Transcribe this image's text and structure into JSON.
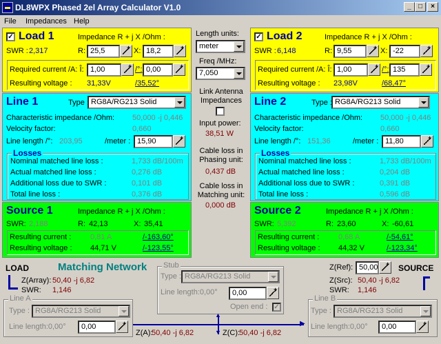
{
  "window": {
    "title": "DL8WPX Phased 2el Array Calculator V1.0",
    "min": "_",
    "max": "□",
    "close": "×"
  },
  "menu": [
    "File",
    "Impedances",
    "Help"
  ],
  "load1": {
    "title": "Load 1",
    "imp_label": "Impedance R + j X /Ohm :",
    "swr_label": "SWR :",
    "swr": "2,317",
    "r_label": "R:",
    "r": "25,5",
    "x_label": "X:",
    "x": "18,2",
    "req_label": "Required current /A: Î:",
    "i": "1,00",
    "phase_label": "/°:",
    "phase": "0,00",
    "volt_label": "Resulting voltage :",
    "volt": "31,33V",
    "volt_phase": "/35,52°"
  },
  "load2": {
    "title": "Load 2",
    "imp_label": "Impedance R + j X /Ohm :",
    "swr_label": "SWR :",
    "swr": "6,148",
    "r_label": "R:",
    "r": "9,55",
    "x_label": "X:",
    "x": "-22",
    "req_label": "Required current /A: Î:",
    "i": "1,00",
    "phase_label": "/°:",
    "phase": "135",
    "volt_label": "Resulting voltage :",
    "volt": "23,98V",
    "volt_phase": "/68,47°"
  },
  "line1": {
    "title": "Line 1",
    "type_label": "Type :",
    "type": "RG8A/RG213 Solid",
    "char_label": "Characteristic impedance /Ohm:",
    "char": "50,000 -j 0,446",
    "vf_label": "Velocity factor:",
    "vf": "0,660",
    "len_label": "Line length /°:",
    "len_deg": "203,95",
    "meter_label": "/meter :",
    "meter": "15,90",
    "losses_title": "Losses",
    "nom_label": "Nominal matched line loss :",
    "nom": "1,733 dB/100m",
    "act_label": "Actual matched line loss :",
    "act": "0,276 dB",
    "add_label": "Additional loss due to SWR :",
    "add": "0,101 dB",
    "tot_label": "Total line loss :",
    "tot": "0,376 dB"
  },
  "line2": {
    "title": "Line 2",
    "type_label": "Type :",
    "type": "RG8A/RG213 Solid",
    "char_label": "Characteristic impedance /Ohm:",
    "char": "50,000 -j 0,446",
    "vf_label": "Velocity factor:",
    "vf": "0,660",
    "len_label": "Line length /°:",
    "len_deg": "151,36",
    "meter_label": "/meter :",
    "meter": "11,80",
    "losses_title": "Losses",
    "nom_label": "Nominal matched line loss :",
    "nom": "1,733 dB/100m",
    "act_label": "Actual matched line loss :",
    "act": "0,204 dB",
    "add_label": "Additional loss due to SWR :",
    "add": "0,391 dB",
    "tot_label": "Total line loss :",
    "tot": "0,596 dB"
  },
  "source1": {
    "title": "Source 1",
    "imp_label": "Impedance R + j X /Ohm :",
    "swr_label": "SWR:",
    "swr": "2,188",
    "r_label": "R:",
    "r": "42,13",
    "x_label": "X:",
    "x": "35,41",
    "cur_label": "Resulting current :",
    "cur": "0,81 A",
    "cur_phase": "/-163,60°",
    "volt_label": "Resulting voltage :",
    "volt": "44,71 V",
    "volt_phase": "/-123,55°"
  },
  "source2": {
    "title": "Source 2",
    "imp_label": "Impedance R + j X /Ohm :",
    "swr_label": "SWR:",
    "swr": "5,392",
    "r_label": "R:",
    "r": "23,60",
    "x_label": "X:",
    "x": "-60,61",
    "cur_label": "Resulting current :",
    "cur": "0,68 A",
    "cur_phase": "/-54,61°",
    "volt_label": "Resulting voltage :",
    "volt": "44,32 V",
    "volt_phase": "/-123,34°"
  },
  "center": {
    "len_units_label": "Length units:",
    "len_units": "meter",
    "freq_label": "Freq /MHz:",
    "freq": "7,050",
    "link_label": "Link Antenna Impedances",
    "input_power_label": "Input power:",
    "input_power": "38,51 W",
    "phasing_label": "Cable loss in Phasing unit:",
    "phasing": "0,437 dB",
    "matching_label": "Cable loss in Matching unit:",
    "matching": "0,000 dB"
  },
  "matching": {
    "load_label": "LOAD",
    "title": "Matching Network",
    "zarray_label": "Z(Array):",
    "zarray": "50,40 -j 6,82",
    "swr_label": "SWR:",
    "swr": "1,146",
    "source_label": "SOURCE",
    "zref_label": "Z(Ref):",
    "zref": "50,00",
    "zsrc_label": "Z(Src):",
    "zsrc": "50,40 -j 6,82",
    "swr2_label": "SWR:",
    "swr2": "1,146",
    "stub_title": "Stub",
    "stub_type_label": "Type :",
    "stub_type": "RG8A/RG213 Solid",
    "stub_len_label": "Line length:0,00°",
    "stub_len": "0,00",
    "open_end_label": "Open end :",
    "linea_title": "Line A",
    "linea_type_label": "Type :",
    "linea_type": "RG8A/RG213 Solid",
    "linea_len_label": "Line length:0,00°",
    "linea_len": "0,00",
    "lineb_title": "Line B",
    "lineb_type_label": "Type :",
    "lineb_type": "RG8A/RG213 Solid",
    "lineb_len_label": "Line length:0,00°",
    "lineb_len": "0,00",
    "za_label": "Z(A):",
    "za": "50,40 -j 6,82",
    "zc_label": "Z(C):",
    "zc": "50,40 -j 6,82"
  }
}
